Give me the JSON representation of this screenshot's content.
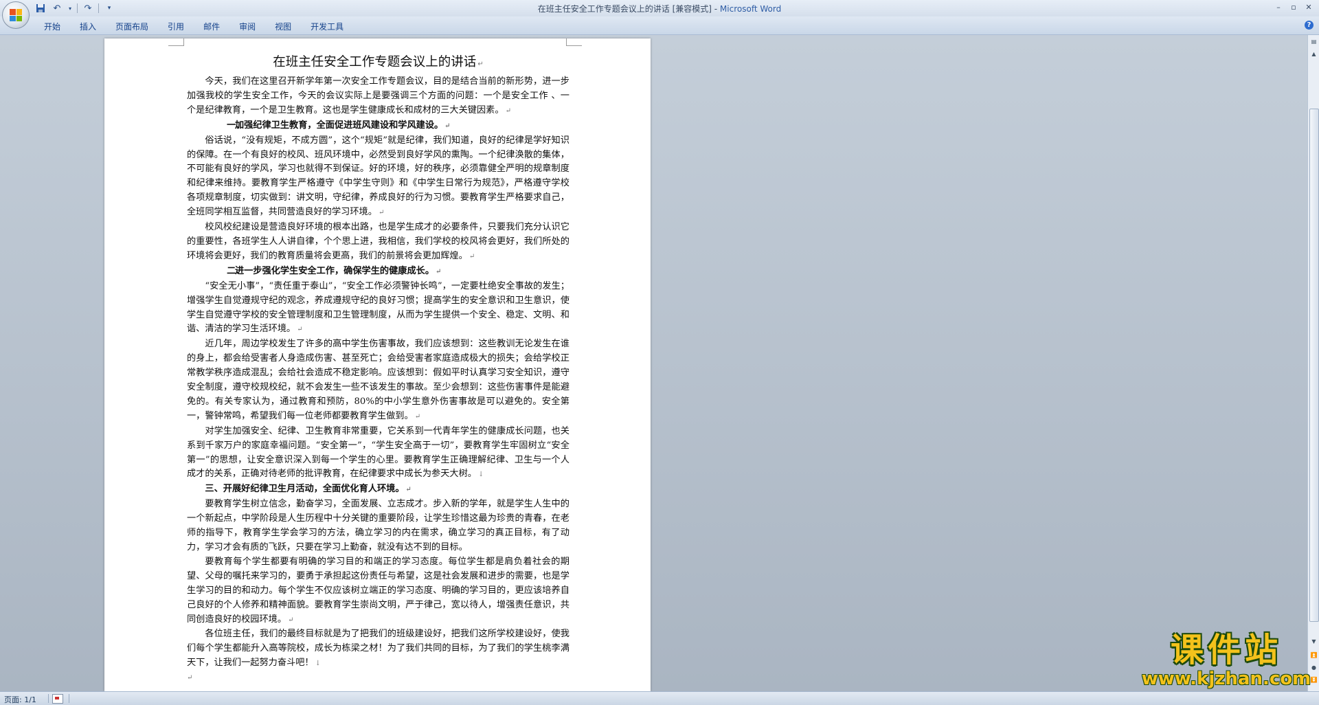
{
  "window": {
    "title": "在班主任安全工作专题会议上的讲话 [兼容模式] - ",
    "app_name": "Microsoft Word",
    "controls": [
      "–",
      "▫",
      "✕"
    ]
  },
  "quick_access": {
    "save": "save-icon",
    "undo": "undo-icon",
    "redo": "redo-icon",
    "customize": "▾"
  },
  "ribbon": {
    "tabs": [
      "开始",
      "插入",
      "页面布局",
      "引用",
      "邮件",
      "审阅",
      "视图",
      "开发工具"
    ],
    "help": "?"
  },
  "document": {
    "title": "在班主任安全工作专题会议上的讲话",
    "paragraphs": [
      "今天，我们在这里召开新学年第一次安全工作专题会议，目的是结合当前的新形势，进一步加强我校的学生安全工作，今天的会议实际上是要强调三个方面的问题：一个是安全工作 、一个是纪律教育，一个是卫生教育。这也是学生健康成长和成材的三大关键因素。",
      "俗话说，“没有规矩，不成方圆”，这个“规矩”就是纪律，我们知道，良好的纪律是学好知识的保障。在一个有良好的校风、班风环境中，必然受到良好学风的熏陶。一个纪律涣散的集体，不可能有良好的学风，学习也就得不到保证。好的环境，好的秩序，必须靠健全严明的规章制度和纪律来维持。要教育学生严格遵守《中学生守则》和《中学生日常行为规范》，严格遵守学校各项规章制度，切实做到：讲文明，守纪律，养成良好的行为习惯。要教育学生严格要求自己，全班同学相互监督，共同营造良好的学习环境。",
      "校风校纪建设是营造良好环境的根本出路，也是学生成才的必要条件，只要我们充分认识它的重要性，各班学生人人讲自律，个个思上进，我相信，我们学校的校风将会更好，我们所处的环境将会更好，我们的教育质量将会更高，我们的前景将会更加辉煌。",
      "“安全无小事”，“责任重于泰山”，“安全工作必须警钟长鸣”，一定要杜绝安全事故的发生；增强学生自觉遵规守纪的观念，养成遵规守纪的良好习惯；提高学生的安全意识和卫生意识，使学生自觉遵守学校的安全管理制度和卫生管理制度，从而为学生提供一个安全、稳定、文明、和谐、清洁的学习生活环境。",
      "近几年，周边学校发生了许多的高中学生伤害事故，我们应该想到：这些教训无论发生在谁的身上，都会给受害者人身造成伤害、甚至死亡；会给受害者家庭造成极大的损失；会给学校正常教学秩序造成混乱；会给社会造成不稳定影响。应该想到：假如平时认真学习安全知识，遵守安全制度，遵守校规校纪，就不会发生一些不该发生的事故。至少会想到：这些伤害事件是能避免的。有关专家认为，通过教育和预防，80%的中小学生意外伤害事故是可以避免的。安全第一，警钟常鸣，希望我们每一位老师都要教育学生做到。",
      "对学生加强安全、纪律、卫生教育非常重要，它关系到一代青年学生的健康成长问题，也关系到千家万户的家庭幸福问题。“安全第一”，“学生安全高于一切”，要教育学生牢固树立“安全第一”的思想，让安全意识深入到每一个学生的心里。要教育学生正确理解纪律、卫生与一个人成才的关系，正确对待老师的批评教育，在纪律要求中成长为参天大树。",
      "要教育学生树立信念，勤奋学习，全面发展、立志成才。步入新的学年，就是学生人生中的一个新起点，中学阶段是人生历程中十分关键的重要阶段，让学生珍惜这最为珍贵的青春，在老师的指导下，教育学生学会学习的方法，确立学习的内在需求，确立学习的真正目标，有了动力，学习才会有质的飞跃，只要在学习上勤奋，就没有达不到的目标。",
      "要教育每个学生都要有明确的学习目的和端正的学习态度。每位学生都是肩负着社会的期望、父母的嘱托来学习的，要勇于承担起这份责任与希望，这是社会发展和进步的需要，也是学生学习的目的和动力。每个学生不仅应该树立端正的学习态度、明确的学习目的，更应该培养自己良好的个人修养和精神面貌。要教育学生崇尚文明，严于律己，宽以待人，增强责任意识，共同创造良好的校园环境。",
      "各位班主任，我们的最终目标就是为了把我们的班级建设好，把我们这所学校建设好，使我们每个学生都能升入高等院校，成长为栋梁之材！为了我们共同的目标，为了我们的学生桃李满天下，让我们一起努力奋斗吧！"
    ],
    "headings": [
      {
        "num": "一、",
        "text": "加强纪律卫生教育，全面促进班风建设和学风建设。"
      },
      {
        "num": "二、",
        "text": "进一步强化学生安全工作，确保学生的健康成长。"
      },
      {
        "num": "",
        "text": "三、开展好纪律卫生月活动，全面优化育人环境。"
      }
    ],
    "marks": {
      "para": "↵",
      "line": "↓"
    }
  },
  "status": {
    "page": "页面: 1/1"
  },
  "watermark": {
    "title": "课件站",
    "url": "www.kjzhan.com"
  },
  "colors": {
    "workspace": "#aab5c2",
    "ribbon_text": "#15428b",
    "app_name": "#2f5da5",
    "watermark_fill": "#f3c21b",
    "watermark_stroke": "#1d4a0c"
  }
}
